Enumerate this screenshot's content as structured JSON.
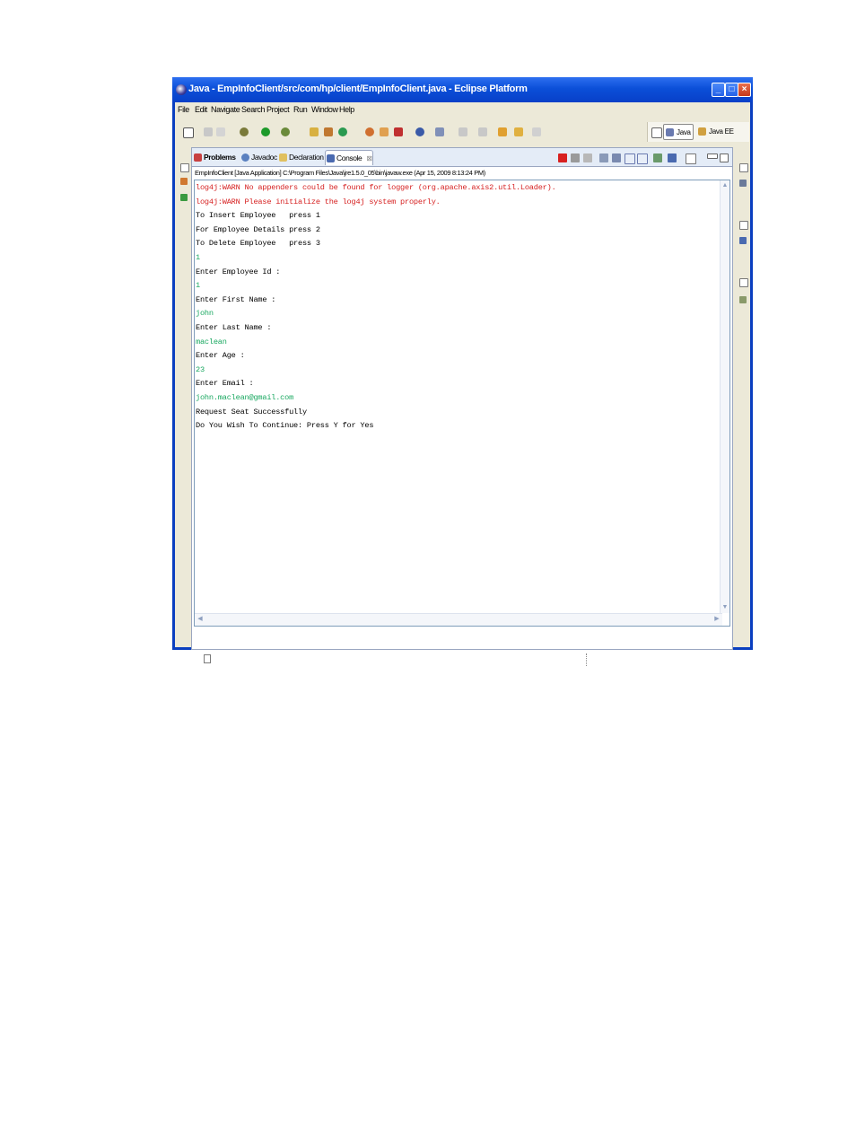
{
  "window": {
    "title": "Java - EmpInfoClient/src/com/hp/client/EmpInfoClient.java - Eclipse Platform"
  },
  "menu": [
    "File",
    "Edit",
    "Navigate",
    "Search",
    "Project",
    "Run",
    "Window",
    "Help"
  ],
  "perspectives": [
    {
      "label": "Java",
      "active": true
    },
    {
      "label": "Java EE",
      "active": false
    }
  ],
  "tabs": [
    {
      "label": "Problems",
      "icon": "problems-icon",
      "active": false
    },
    {
      "label": "Javadoc",
      "icon": "javadoc-icon",
      "active": false
    },
    {
      "label": "Declaration",
      "icon": "declaration-icon",
      "active": false
    },
    {
      "label": "Console",
      "icon": "console-icon",
      "active": true
    }
  ],
  "console": {
    "label": "EmpInfoClient [Java Application] C:\\Program Files\\Java\\jre1.5.0_05\\bin\\javaw.exe (Apr 15, 2009 8:13:24 PM)",
    "lines": [
      {
        "text": "log4j:WARN No appenders could be found for logger (org.apache.axis2.util.Loader).",
        "kind": "error"
      },
      {
        "text": "log4j:WARN Please initialize the log4j system properly.",
        "kind": "error"
      },
      {
        "text": "To Insert Employee   press 1",
        "kind": "output"
      },
      {
        "text": "For Employee Details press 2",
        "kind": "output"
      },
      {
        "text": "To Delete Employee   press 3",
        "kind": "output"
      },
      {
        "text": "1",
        "kind": "input"
      },
      {
        "text": "Enter Employee Id :",
        "kind": "output"
      },
      {
        "text": "1",
        "kind": "input"
      },
      {
        "text": "Enter First Name :",
        "kind": "output"
      },
      {
        "text": "john",
        "kind": "input"
      },
      {
        "text": "Enter Last Name :",
        "kind": "output"
      },
      {
        "text": "maclean",
        "kind": "input"
      },
      {
        "text": "Enter Age :",
        "kind": "output"
      },
      {
        "text": "23",
        "kind": "input"
      },
      {
        "text": "Enter Email :",
        "kind": "output"
      },
      {
        "text": "john.maclean@gmail.com",
        "kind": "input"
      },
      {
        "text": "Request Seat Successfully",
        "kind": "output"
      },
      {
        "text": "Do You Wish To Continue: Press Y for Yes",
        "kind": "output"
      }
    ]
  },
  "colors": {
    "error": "#d62020",
    "input": "#19a860",
    "output": "#000000",
    "titlebar": "#0b4fd8"
  }
}
